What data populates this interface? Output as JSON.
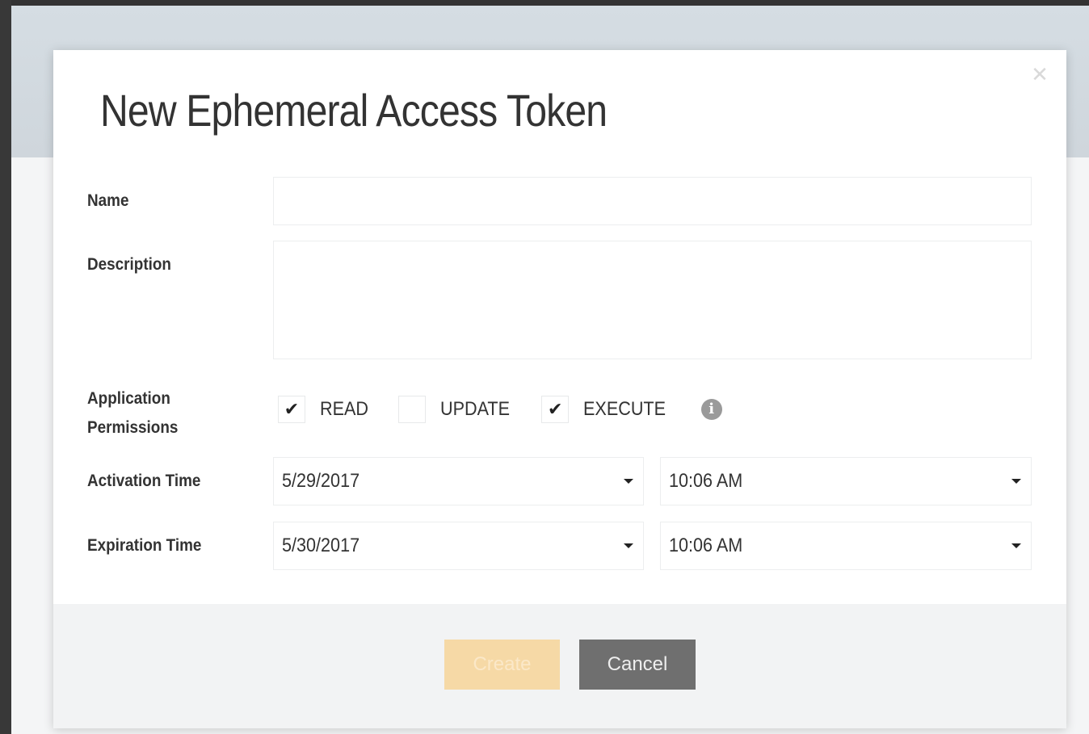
{
  "dialog": {
    "title": "New Ephemeral Access Token",
    "close_icon": "close-icon"
  },
  "form": {
    "name": {
      "label": "Name",
      "value": "",
      "placeholder": ""
    },
    "description": {
      "label": "Description",
      "value": "",
      "placeholder": ""
    },
    "permissions": {
      "label_line1": "Application",
      "label_line2": "Permissions",
      "items": [
        {
          "label": "READ",
          "checked": true,
          "mark": "✔"
        },
        {
          "label": "UPDATE",
          "checked": false,
          "mark": ""
        },
        {
          "label": "EXECUTE",
          "checked": true,
          "mark": "✔"
        }
      ],
      "info_glyph": "i"
    },
    "activation": {
      "label": "Activation Time",
      "date": "5/29/2017",
      "time": "10:06 AM"
    },
    "expiration": {
      "label": "Expiration Time",
      "date": "5/30/2017",
      "time": "10:06 AM"
    }
  },
  "footer": {
    "create_label": "Create",
    "cancel_label": "Cancel"
  },
  "colors": {
    "create_button": "#f6d9a6",
    "cancel_button": "#6f6f6f"
  }
}
